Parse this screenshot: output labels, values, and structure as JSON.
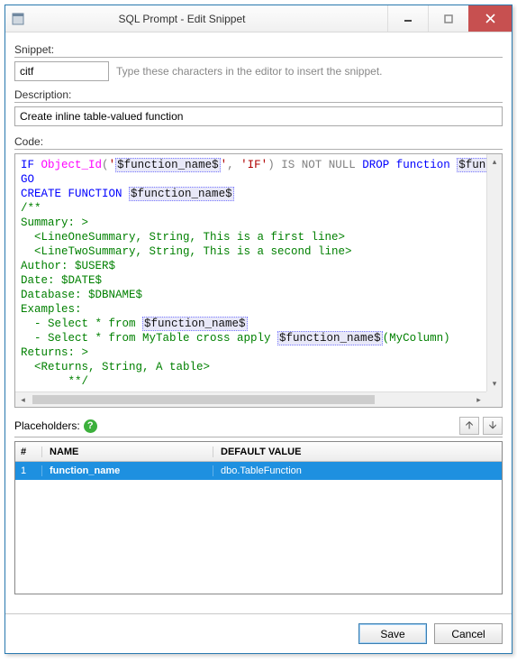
{
  "window": {
    "title": "SQL Prompt - Edit Snippet"
  },
  "labels": {
    "snippet": "Snippet:",
    "description": "Description:",
    "code": "Code:",
    "placeholders": "Placeholders:"
  },
  "hint": "Type these characters in the editor to insert the snippet.",
  "fields": {
    "snippet_value": "citf",
    "description_value": "Create inline table-valued function"
  },
  "code": {
    "if": "IF",
    "objid": "Object_Id",
    "lparen": "(",
    "sq1": "'",
    "ph_fn": "$function_name$",
    "sq2": "'",
    "comma": ", ",
    "sq3": "'",
    "if_literal": "IF",
    "sq4": "'",
    "rparen": ")",
    "isnotnull": " IS NOT NULL ",
    "drop": "DROP",
    "function_kw": " function ",
    "ph_fn_tail": "$funct",
    "go": "GO",
    "create": "CREATE FUNCTION",
    "space": " ",
    "comment_open": "/**",
    "summary": "Summary: >",
    "line1": "  <LineOneSummary, String, This is a first line>",
    "line2": "  <LineTwoSummary, String, This is a second line>",
    "author": "Author: $USER$",
    "date": "Date: $DATE$",
    "database": "Database: $DBNAME$",
    "examples": "Examples:",
    "ex1_pre": "  - Select * from ",
    "ex2_pre": "  - Select * from MyTable cross apply ",
    "ex2_post": "(MyColumn)",
    "returns": "Returns: >",
    "returns_line": "  <Returns, String, A table>",
    "comment_close": "       **/"
  },
  "grid": {
    "headers": {
      "num": "#",
      "name": "NAME",
      "def": "DEFAULT VALUE"
    },
    "rows": [
      {
        "num": "1",
        "name": "function_name",
        "def": "dbo.TableFunction"
      }
    ]
  },
  "buttons": {
    "save": "Save",
    "cancel": "Cancel"
  }
}
